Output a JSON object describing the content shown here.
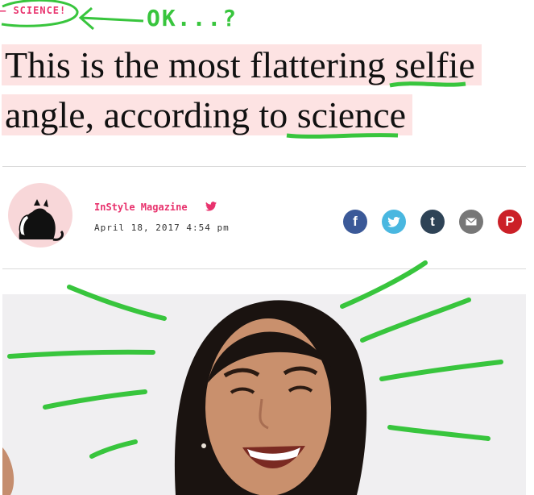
{
  "section_tag": "– SCIENCE!",
  "annotation": "OK...?",
  "headline": {
    "line1": "This is the most flattering selfie",
    "line2": "angle, according to science"
  },
  "author": {
    "name": "InStyle Magazine",
    "date": "April 18, 2017 4:54 pm"
  },
  "share": [
    {
      "icon": "facebook-icon",
      "glyph": "f",
      "color": "#3b5998"
    },
    {
      "icon": "twitter-icon",
      "glyph": "",
      "color": "#49b7e0"
    },
    {
      "icon": "tumblr-icon",
      "glyph": "t",
      "color": "#2e4356"
    },
    {
      "icon": "mail-icon",
      "glyph": "",
      "color": "#777777"
    },
    {
      "icon": "pinterest-icon",
      "glyph": "P",
      "color": "#cb2027"
    }
  ],
  "colors": {
    "accent": "#e8326d",
    "highlight": "#fde3e3",
    "scribble": "#38c53d"
  }
}
